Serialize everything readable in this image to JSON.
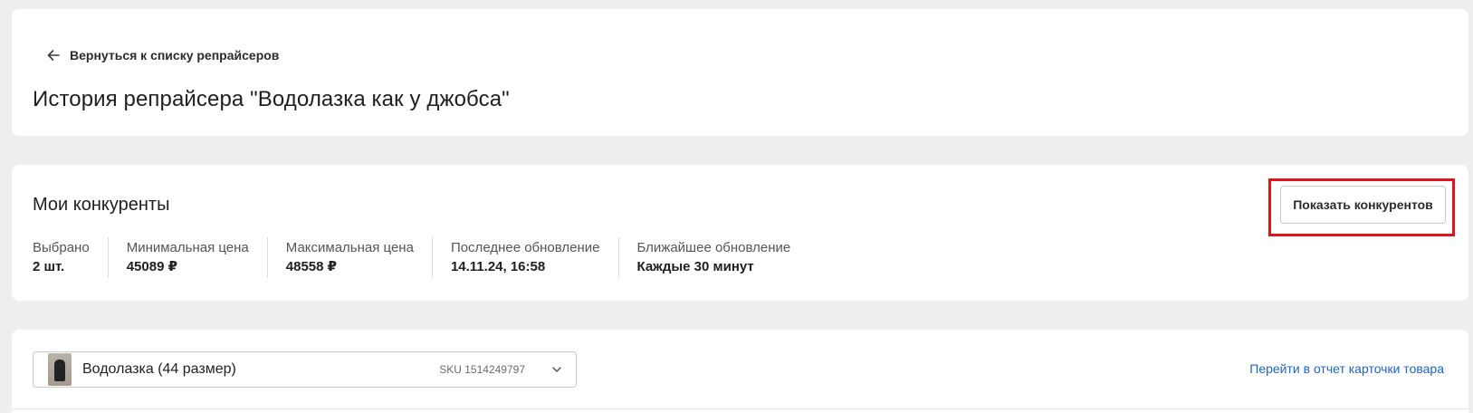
{
  "header": {
    "back_label": "Вернуться к списку репрайсеров",
    "title": "История репрайсера \"Водолазка как у джобса\""
  },
  "competitors": {
    "title": "Мои конкуренты",
    "show_button": "Показать конкурентов",
    "stats": [
      {
        "label": "Выбрано",
        "value": "2 шт."
      },
      {
        "label": "Минимальная цена",
        "value": "45089 ₽"
      },
      {
        "label": "Максимальная цена",
        "value": "48558 ₽"
      },
      {
        "label": "Последнее обновление",
        "value": "14.11.24, 16:58"
      },
      {
        "label": "Ближайшее обновление",
        "value": "Каждые 30 минут"
      }
    ]
  },
  "product": {
    "name": "Водолазка (44 размер)",
    "sku": "SKU 1514249797",
    "report_link": "Перейти в отчет карточки товара"
  },
  "colors": {
    "accent_link": "#1f63c8",
    "highlight": "#e0151b",
    "background": "#eeeeee"
  },
  "icons": [
    "arrow-left-icon",
    "chevron-down-icon",
    "product-thumbnail"
  ]
}
